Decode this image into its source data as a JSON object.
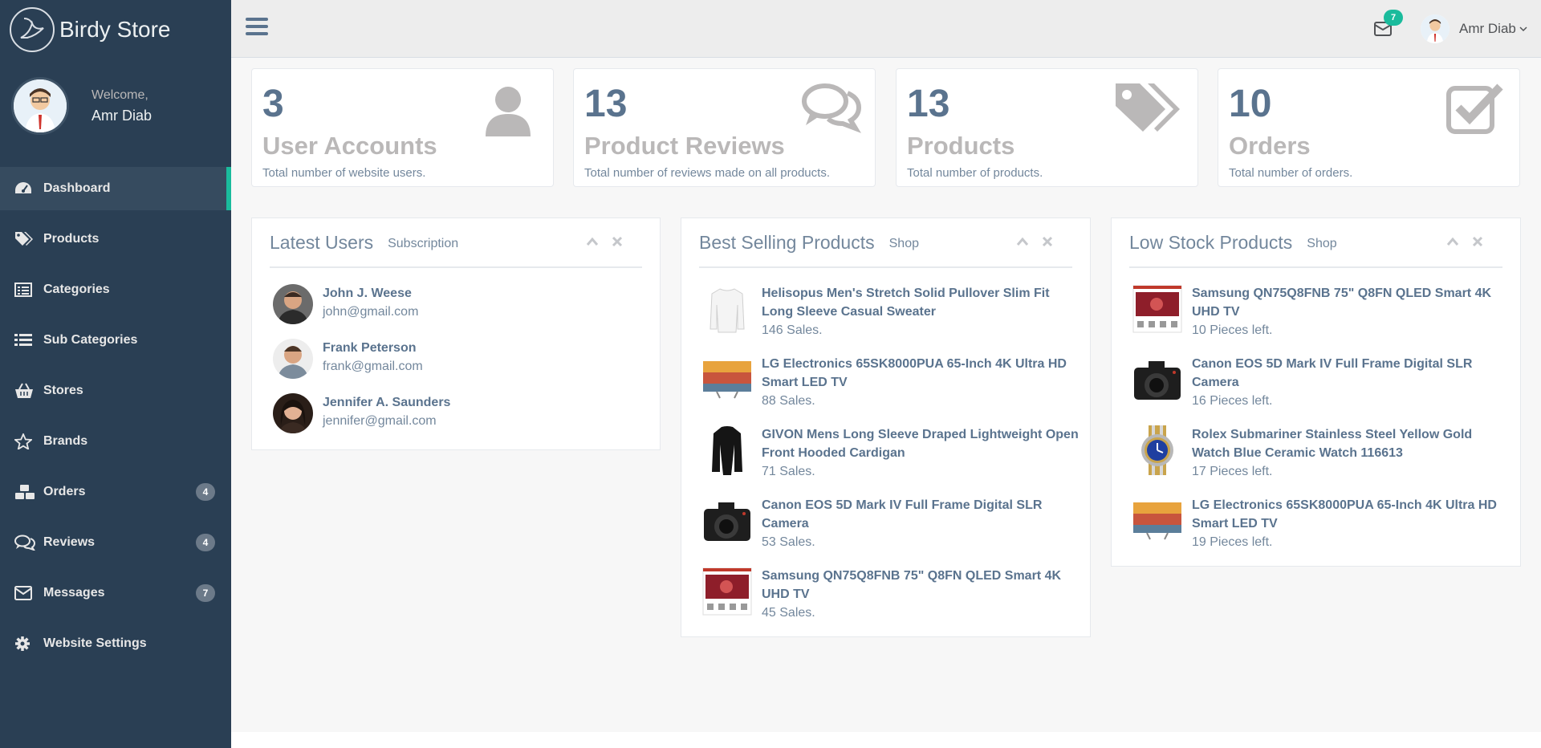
{
  "brand": {
    "name": "Birdy Store"
  },
  "profile": {
    "welcome": "Welcome,",
    "name": "Amr Diab"
  },
  "sidebar": {
    "items": [
      {
        "label": "Dashboard",
        "icon": "dashboard-icon"
      },
      {
        "label": "Products",
        "icon": "tags-icon"
      },
      {
        "label": "Categories",
        "icon": "list-alt-icon"
      },
      {
        "label": "Sub Categories",
        "icon": "list-icon"
      },
      {
        "label": "Stores",
        "icon": "basket-icon"
      },
      {
        "label": "Brands",
        "icon": "star-icon"
      },
      {
        "label": "Orders",
        "icon": "cubes-icon",
        "badge": "4"
      },
      {
        "label": "Reviews",
        "icon": "comments-icon",
        "badge": "4"
      },
      {
        "label": "Messages",
        "icon": "envelope-icon",
        "badge": "7"
      },
      {
        "label": "Website Settings",
        "icon": "gear-icon"
      }
    ]
  },
  "topnav": {
    "mail_count": "7",
    "user_name": "Amr Diab"
  },
  "tiles": [
    {
      "count": "3",
      "title": "User Accounts",
      "desc": "Total number of website users.",
      "icon": "user-icon"
    },
    {
      "count": "13",
      "title": "Product Reviews",
      "desc": "Total number of reviews made on all products.",
      "icon": "comments-icon"
    },
    {
      "count": "13",
      "title": "Products",
      "desc": "Total number of products.",
      "icon": "tags-icon"
    },
    {
      "count": "10",
      "title": "Orders",
      "desc": "Total number of orders.",
      "icon": "check-square-icon"
    }
  ],
  "latest_users": {
    "title": "Latest Users",
    "subtitle": "Subscription",
    "items": [
      {
        "name": "John J. Weese",
        "email": "john@gmail.com"
      },
      {
        "name": "Frank Peterson",
        "email": "frank@gmail.com"
      },
      {
        "name": "Jennifer A. Saunders",
        "email": "jennifer@gmail.com"
      }
    ]
  },
  "best_selling": {
    "title": "Best Selling Products",
    "subtitle": "Shop",
    "items": [
      {
        "line1": "Helisopus Men's Stretch Solid Pullover Slim Fit",
        "line2": "Long Sleeve Casual Sweater",
        "meta": "146 Sales."
      },
      {
        "line1": "LG Electronics 65SK8000PUA 65-Inch 4K Ultra HD",
        "line2": "Smart LED TV",
        "meta": "88 Sales."
      },
      {
        "line1": "GIVON Mens Long Sleeve Draped Lightweight Open",
        "line2": "Front Hooded Cardigan",
        "meta": "71 Sales."
      },
      {
        "line1": "Canon EOS 5D Mark IV Full Frame Digital SLR",
        "line2": "Camera",
        "meta": "53 Sales."
      },
      {
        "line1": "Samsung QN75Q8FNB 75\" Q8FN QLED Smart 4K",
        "line2": "UHD TV",
        "meta": "45 Sales."
      }
    ]
  },
  "low_stock": {
    "title": "Low Stock Products",
    "subtitle": "Shop",
    "items": [
      {
        "line1": "Samsung QN75Q8FNB 75\" Q8FN QLED Smart 4K",
        "line2": "UHD TV",
        "meta": "10 Pieces left."
      },
      {
        "line1": "Canon EOS 5D Mark IV Full Frame Digital SLR",
        "line2": "Camera",
        "meta": "16 Pieces left."
      },
      {
        "line1": "Rolex Submariner Stainless Steel Yellow Gold",
        "line2": "Watch Blue Ceramic Watch 116613",
        "meta": "17 Pieces left."
      },
      {
        "line1": "LG Electronics 65SK8000PUA 65-Inch 4K Ultra HD",
        "line2": "Smart LED TV",
        "meta": "19 Pieces left."
      }
    ]
  },
  "colors": {
    "sidebar": "#2A3F54",
    "accent": "#1ABB9C",
    "text": "#73879C",
    "heading": "#5A738E"
  }
}
